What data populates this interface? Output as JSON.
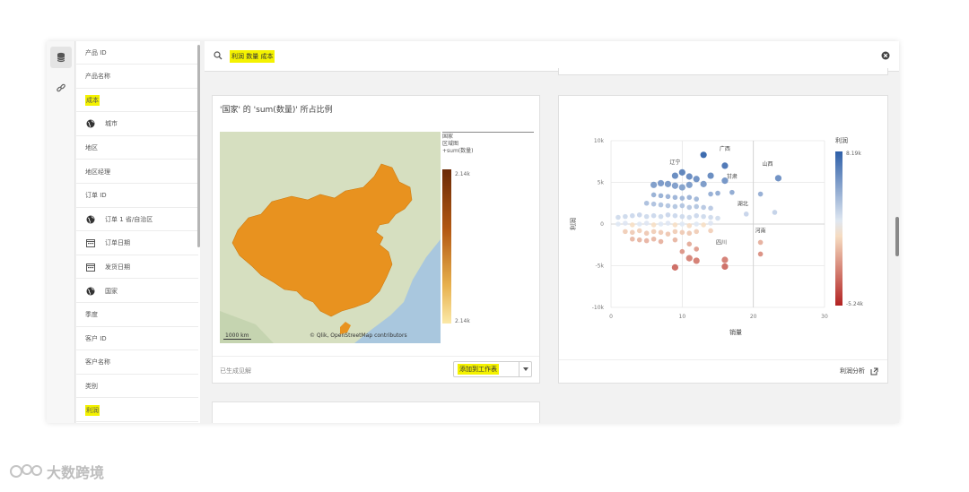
{
  "fields": [
    {
      "label": "产品 ID",
      "icon": "",
      "highlight": false
    },
    {
      "label": "产品名称",
      "icon": "",
      "highlight": false
    },
    {
      "label": "成本",
      "icon": "",
      "highlight": true
    },
    {
      "label": "城市",
      "icon": "globe-icon",
      "highlight": false
    },
    {
      "label": "地区",
      "icon": "",
      "highlight": false
    },
    {
      "label": "地区经理",
      "icon": "",
      "highlight": false
    },
    {
      "label": "订单 ID",
      "icon": "",
      "highlight": false
    },
    {
      "label": "订单 1 省/自治区",
      "icon": "globe-icon",
      "highlight": false
    },
    {
      "label": "订单日期",
      "icon": "calendar-icon",
      "highlight": false
    },
    {
      "label": "发货日期",
      "icon": "calendar-icon",
      "highlight": false
    },
    {
      "label": "国家",
      "icon": "globe-icon",
      "highlight": false
    },
    {
      "label": "季度",
      "icon": "",
      "highlight": false
    },
    {
      "label": "客户 ID",
      "icon": "",
      "highlight": false
    },
    {
      "label": "客户名称",
      "icon": "",
      "highlight": false
    },
    {
      "label": "类别",
      "icon": "",
      "highlight": false
    },
    {
      "label": "利润",
      "icon": "",
      "highlight": true
    }
  ],
  "search": {
    "value": "利润 数量 成本"
  },
  "map_card": {
    "title": "'国家' 的 'sum(数量)' 所占比例",
    "scale_label": "1000 km",
    "attribution": "© Qlik, OpenStreetMap contributors",
    "legend_title_1": "国家",
    "legend_title_2": "区域图",
    "legend_series": "+sum(数量)",
    "legend_max": "2.14k",
    "legend_min": "2.14k",
    "footer_left": "已生成见解",
    "add_button": "添加到工作表",
    "fill_color": "#e8921f"
  },
  "chart_data": {
    "type": "scatter",
    "xlabel": "销量",
    "ylabel": "利润",
    "x_ticks": [
      "0",
      "10",
      "20",
      "30"
    ],
    "y_ticks": [
      "10k",
      "5k",
      "0",
      "-5k",
      "-10k"
    ],
    "xlim": [
      0,
      30
    ],
    "ylim": [
      -10000,
      10000
    ],
    "color_legend_title": "利润",
    "color_legend_max": "8.19k",
    "color_legend_min": "-5.24k",
    "color_high": "#2e5fa8",
    "color_low": "#b22222",
    "labels": [
      {
        "text": "广西",
        "x": 16,
        "y": 8800
      },
      {
        "text": "辽宁",
        "x": 9,
        "y": 7200
      },
      {
        "text": "山西",
        "x": 22,
        "y": 7000
      },
      {
        "text": "甘肃",
        "x": 17,
        "y": 5500
      },
      {
        "text": "湖北",
        "x": 18.5,
        "y": 2200
      },
      {
        "text": "河南",
        "x": 21,
        "y": -1000
      },
      {
        "text": "四川",
        "x": 15.5,
        "y": -2400
      }
    ],
    "points": [
      {
        "x": 13,
        "y": 8300
      },
      {
        "x": 16,
        "y": 7000
      },
      {
        "x": 9,
        "y": 5800
      },
      {
        "x": 10,
        "y": 6200
      },
      {
        "x": 11,
        "y": 5700
      },
      {
        "x": 12,
        "y": 5400
      },
      {
        "x": 14,
        "y": 5800
      },
      {
        "x": 16,
        "y": 5200
      },
      {
        "x": 23.5,
        "y": 5500
      },
      {
        "x": 6,
        "y": 4700
      },
      {
        "x": 7,
        "y": 4900
      },
      {
        "x": 8,
        "y": 4800
      },
      {
        "x": 9,
        "y": 4600
      },
      {
        "x": 10,
        "y": 4400
      },
      {
        "x": 11,
        "y": 4700
      },
      {
        "x": 13,
        "y": 4800
      },
      {
        "x": 14,
        "y": 3600
      },
      {
        "x": 15,
        "y": 3700
      },
      {
        "x": 17,
        "y": 3800
      },
      {
        "x": 21,
        "y": 3600
      },
      {
        "x": 6,
        "y": 3500
      },
      {
        "x": 7,
        "y": 3400
      },
      {
        "x": 8,
        "y": 3300
      },
      {
        "x": 9,
        "y": 3200
      },
      {
        "x": 10,
        "y": 3100
      },
      {
        "x": 11,
        "y": 3200
      },
      {
        "x": 12,
        "y": 3000
      },
      {
        "x": 5,
        "y": 2500
      },
      {
        "x": 6,
        "y": 2400
      },
      {
        "x": 7,
        "y": 2300
      },
      {
        "x": 8,
        "y": 2200
      },
      {
        "x": 9,
        "y": 2100
      },
      {
        "x": 10,
        "y": 2200
      },
      {
        "x": 11,
        "y": 2000
      },
      {
        "x": 12,
        "y": 2100
      },
      {
        "x": 13,
        "y": 2000
      },
      {
        "x": 14,
        "y": 1900
      },
      {
        "x": 23,
        "y": 1400
      },
      {
        "x": 19,
        "y": 1200
      },
      {
        "x": 1,
        "y": 800
      },
      {
        "x": 2,
        "y": 900
      },
      {
        "x": 3,
        "y": 1000
      },
      {
        "x": 4,
        "y": 1100
      },
      {
        "x": 5,
        "y": 900
      },
      {
        "x": 6,
        "y": 1000
      },
      {
        "x": 7,
        "y": 900
      },
      {
        "x": 8,
        "y": 1100
      },
      {
        "x": 9,
        "y": 1000
      },
      {
        "x": 10,
        "y": 900
      },
      {
        "x": 11,
        "y": 800
      },
      {
        "x": 12,
        "y": 1000
      },
      {
        "x": 13,
        "y": 900
      },
      {
        "x": 14,
        "y": 800
      },
      {
        "x": 15,
        "y": 700
      },
      {
        "x": 1,
        "y": 0
      },
      {
        "x": 2,
        "y": 100
      },
      {
        "x": 3,
        "y": -100
      },
      {
        "x": 4,
        "y": 0
      },
      {
        "x": 5,
        "y": 100
      },
      {
        "x": 6,
        "y": -100
      },
      {
        "x": 7,
        "y": 0
      },
      {
        "x": 8,
        "y": 100
      },
      {
        "x": 9,
        "y": -100
      },
      {
        "x": 10,
        "y": 0
      },
      {
        "x": 11,
        "y": -200
      },
      {
        "x": 12,
        "y": 0
      },
      {
        "x": 13,
        "y": -100
      },
      {
        "x": 14,
        "y": 100
      },
      {
        "x": 2,
        "y": -900
      },
      {
        "x": 3,
        "y": -1000
      },
      {
        "x": 4,
        "y": -800
      },
      {
        "x": 5,
        "y": -1100
      },
      {
        "x": 6,
        "y": -900
      },
      {
        "x": 7,
        "y": -1000
      },
      {
        "x": 8,
        "y": -1200
      },
      {
        "x": 9,
        "y": -900
      },
      {
        "x": 10,
        "y": -1000
      },
      {
        "x": 11,
        "y": -1100
      },
      {
        "x": 12,
        "y": -900
      },
      {
        "x": 14,
        "y": -800
      },
      {
        "x": 3,
        "y": -1800
      },
      {
        "x": 4,
        "y": -1900
      },
      {
        "x": 5,
        "y": -2000
      },
      {
        "x": 6,
        "y": -1800
      },
      {
        "x": 7,
        "y": -2100
      },
      {
        "x": 9,
        "y": -1900
      },
      {
        "x": 11,
        "y": -2400
      },
      {
        "x": 21,
        "y": -2200
      },
      {
        "x": 12,
        "y": -3000
      },
      {
        "x": 10,
        "y": -3300
      },
      {
        "x": 21,
        "y": -3600
      },
      {
        "x": 16,
        "y": -4300
      },
      {
        "x": 12,
        "y": -4400
      },
      {
        "x": 11,
        "y": -4100
      },
      {
        "x": 9,
        "y": -5200
      },
      {
        "x": 16,
        "y": -5100
      }
    ]
  },
  "scatter_card": {
    "footer_label": "利润分析"
  },
  "watermark": {
    "text": "大数跨境"
  }
}
